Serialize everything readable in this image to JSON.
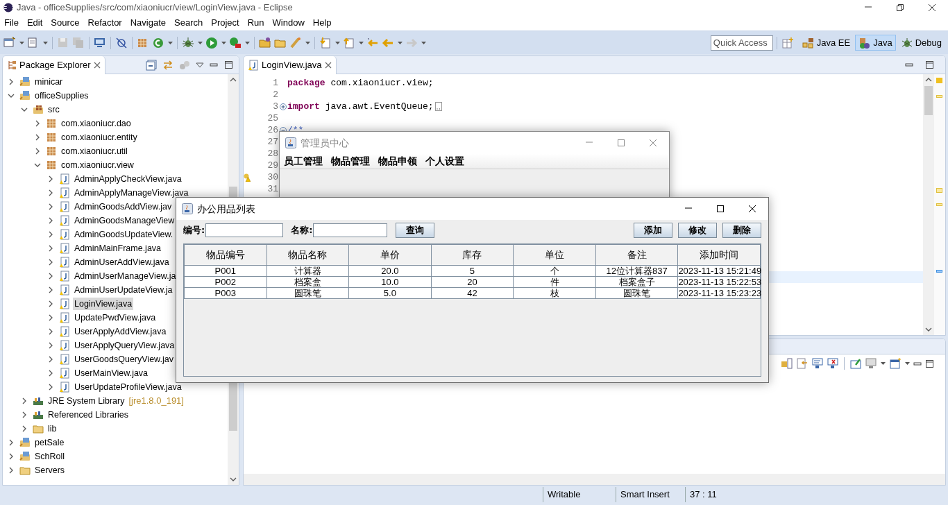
{
  "window": {
    "title": "Java - officeSupplies/src/com/xiaoniucr/view/LoginView.java - Eclipse"
  },
  "menu": [
    "File",
    "Edit",
    "Source",
    "Refactor",
    "Navigate",
    "Search",
    "Project",
    "Run",
    "Window",
    "Help"
  ],
  "quick_access": {
    "placeholder": "Quick Access"
  },
  "perspectives": [
    {
      "label": "Java EE",
      "selected": false
    },
    {
      "label": "Java",
      "selected": true
    },
    {
      "label": "Debug",
      "selected": false
    }
  ],
  "package_explorer": {
    "title": "Package Explorer",
    "tree": [
      {
        "label": "minicar",
        "kind": "project",
        "expanded": false,
        "selected": false
      },
      {
        "label": "officeSupplies",
        "kind": "project",
        "expanded": true,
        "selected": false,
        "children": [
          {
            "label": "src",
            "kind": "source",
            "expanded": true,
            "selected": false,
            "children": [
              {
                "label": "com.xiaoniucr.dao",
                "kind": "package",
                "expanded": false,
                "selected": false
              },
              {
                "label": "com.xiaoniucr.entity",
                "kind": "package",
                "expanded": false,
                "selected": false
              },
              {
                "label": "com.xiaoniucr.util",
                "kind": "package",
                "expanded": false,
                "selected": false
              },
              {
                "label": "com.xiaoniucr.view",
                "kind": "package",
                "expanded": true,
                "selected": false,
                "children": [
                  {
                    "label": "AdminApplyCheckView.java",
                    "kind": "file",
                    "expanded": false,
                    "selected": false
                  },
                  {
                    "label": "AdminApplyManageView.java",
                    "kind": "file",
                    "expanded": false,
                    "selected": false
                  },
                  {
                    "label": "AdminGoodsAddView.jav",
                    "kind": "file",
                    "expanded": false,
                    "selected": false
                  },
                  {
                    "label": "AdminGoodsManageView",
                    "kind": "file",
                    "expanded": false,
                    "selected": false
                  },
                  {
                    "label": "AdminGoodsUpdateView.",
                    "kind": "file",
                    "expanded": false,
                    "selected": false
                  },
                  {
                    "label": "AdminMainFrame.java",
                    "kind": "file",
                    "expanded": false,
                    "selected": false
                  },
                  {
                    "label": "AdminUserAddView.java",
                    "kind": "file",
                    "expanded": false,
                    "selected": false
                  },
                  {
                    "label": "AdminUserManageView.ja",
                    "kind": "file",
                    "expanded": false,
                    "selected": false
                  },
                  {
                    "label": "AdminUserUpdateView.ja",
                    "kind": "file",
                    "expanded": false,
                    "selected": false
                  },
                  {
                    "label": "LoginView.java",
                    "kind": "file",
                    "expanded": false,
                    "selected": true
                  },
                  {
                    "label": "UpdatePwdView.java",
                    "kind": "file",
                    "expanded": false,
                    "selected": false
                  },
                  {
                    "label": "UserApplyAddView.java",
                    "kind": "file",
                    "expanded": false,
                    "selected": false
                  },
                  {
                    "label": "UserApplyQueryView.java",
                    "kind": "file",
                    "expanded": false,
                    "selected": false
                  },
                  {
                    "label": "UserGoodsQueryView.jav",
                    "kind": "file",
                    "expanded": false,
                    "selected": false
                  },
                  {
                    "label": "UserMainView.java",
                    "kind": "file",
                    "expanded": false,
                    "selected": false
                  },
                  {
                    "label": "UserUpdateProfileView.java",
                    "kind": "file",
                    "expanded": false,
                    "selected": false
                  }
                ]
              }
            ]
          },
          {
            "label": "JRE System Library",
            "decoration": "[jre1.8.0_191]",
            "kind": "library",
            "expanded": false,
            "selected": false
          },
          {
            "label": "Referenced Libraries",
            "kind": "library",
            "expanded": false,
            "selected": false
          },
          {
            "label": "lib",
            "kind": "folder",
            "expanded": false,
            "selected": false
          }
        ]
      },
      {
        "label": "petSale",
        "kind": "project",
        "expanded": false,
        "selected": false
      },
      {
        "label": "SchRoll",
        "kind": "project",
        "expanded": false,
        "selected": false
      },
      {
        "label": "Servers",
        "kind": "folder",
        "expanded": false,
        "selected": false
      }
    ]
  },
  "editor": {
    "tab": "LoginView.java",
    "lines": [
      {
        "number": "1",
        "keyword": "package",
        "code": "com.xiaoniucr.view;",
        "warning": false
      },
      {
        "number": "2",
        "warning": false
      },
      {
        "number": "3",
        "folded": true,
        "keyword": "import",
        "code": "java.awt.EventQueue;",
        "warning": false
      },
      {
        "number": "25",
        "warning": false
      },
      {
        "number": "26",
        "folded": false,
        "comment": "/**",
        "warning": false
      },
      {
        "number": "27",
        "warning": false
      },
      {
        "number": "28",
        "warning": false
      },
      {
        "number": "29",
        "warning": false
      },
      {
        "number": "30",
        "warning": true
      },
      {
        "number": "31",
        "warning": false
      }
    ]
  },
  "status_bar": [
    "Writable",
    "Smart Insert",
    "37 : 11"
  ],
  "admin_window": {
    "title": "管理员中心",
    "menu": [
      "员工管理",
      "物品管理",
      "物品申领",
      "个人设置"
    ]
  },
  "goods_dialog": {
    "title": "办公用品列表",
    "fields": [
      {
        "label": "编号:"
      },
      {
        "label": "名称:"
      }
    ],
    "search_button": "查询",
    "action_buttons": [
      "添加",
      "修改",
      "删除"
    ],
    "table": {
      "columns": [
        "物品编号",
        "物品名称",
        "单价",
        "库存",
        "单位",
        "备注",
        "添加时间"
      ],
      "rows": [
        [
          "P001",
          "计算器",
          "20.0",
          "5",
          "个",
          "12位计算器837",
          "2023-11-13 15:21:49"
        ],
        [
          "P002",
          "档案盒",
          "10.0",
          "20",
          "件",
          "档案盒子",
          "2023-11-13 15:22:53"
        ],
        [
          "P003",
          "圆珠笔",
          "5.0",
          "42",
          "枝",
          "圆珠笔",
          "2023-11-13 15:23:23"
        ]
      ]
    }
  }
}
